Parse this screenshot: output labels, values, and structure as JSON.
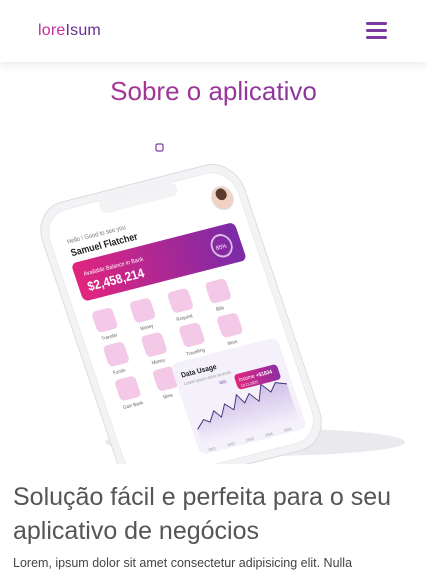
{
  "brand": {
    "part1": "lore",
    "part2": "Isum"
  },
  "page": {
    "title": "Sobre o aplicativo",
    "headline": "Solução fácil e perfeita para o seu aplicativo de negócios",
    "paragraph": "Lorem, ipsum dolor sit amet consectetur adipisicing elit. Nulla"
  },
  "phone": {
    "greeting": "Hello ! Good to see you",
    "user_name": "Samuel Flatcher",
    "balance_label": "Available Balance in Bank",
    "balance": "$2,458,214",
    "badge": "85%",
    "menu_items": [
      "Transfer",
      "Money",
      "Request",
      "Bills",
      "Funds",
      "Money",
      "Travelling",
      "More",
      "Gain Bank",
      "Mine"
    ],
    "chart_title": "Data Usage",
    "chart_subtitle": "Lorem ipsum dolor sit amet",
    "tooltip_label": "Income",
    "tooltip_value": "+$1634",
    "tooltip_date": "10.11.2023",
    "chart_month": "MID",
    "axis_labels": [
      "2001",
      "2002",
      "2003",
      "2004",
      "2005"
    ]
  },
  "colors": {
    "magenta": "#c12d9b",
    "purple": "#6a2c91"
  }
}
